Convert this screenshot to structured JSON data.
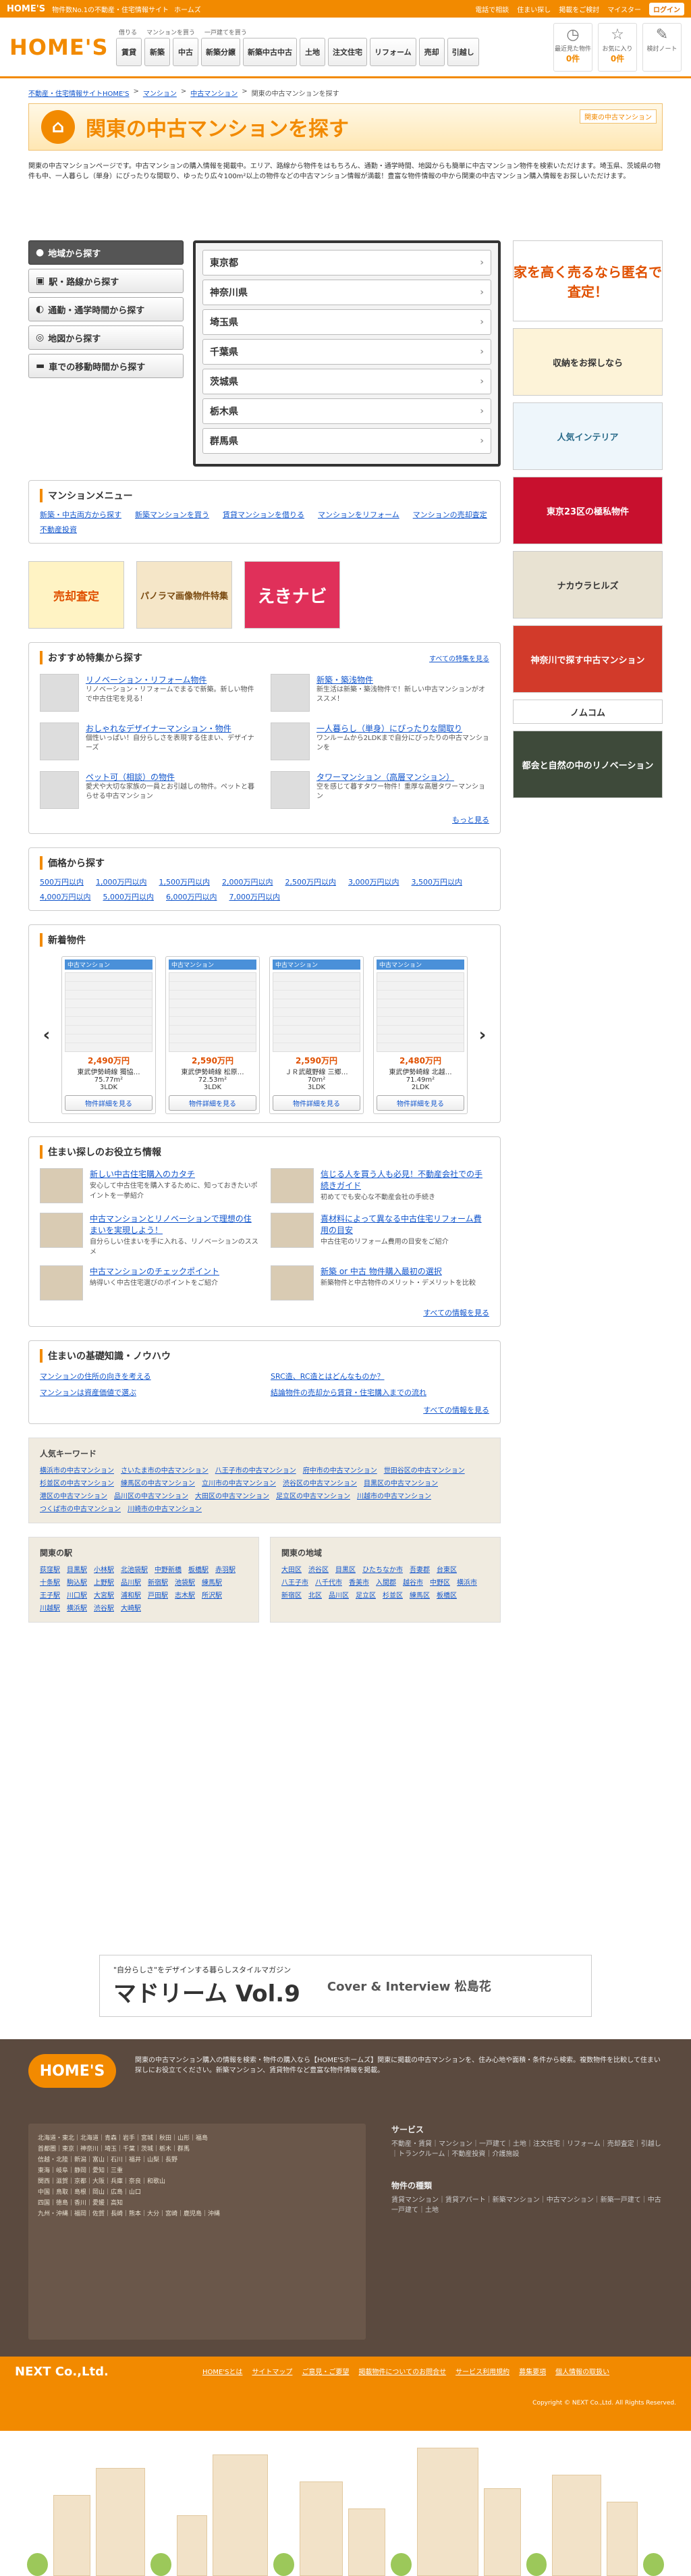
{
  "topbar": {
    "brand": "HOME'S",
    "links": [
      "物件数No.1の不動産・住宅情報サイト",
      "ホームズ"
    ],
    "right": [
      "電話で相談",
      "住まい探し",
      "掲載をご検討",
      "マイスター"
    ],
    "login": "ログイン"
  },
  "header": {
    "logo": "HOME'S",
    "nav_labels": [
      "借りる",
      "マンションを買う",
      "一戸建てを買う"
    ],
    "nav": [
      "賃貸",
      "新築",
      "中古",
      "新築分譲",
      "新築中古中古",
      "土地",
      "注文住宅",
      "リフォーム",
      "売却",
      "引越し"
    ],
    "icons": [
      {
        "name": "最近見た物件",
        "count": "0件"
      },
      {
        "name": "お気に入り",
        "count": "0件"
      },
      {
        "name": "検討ノート",
        "count": ""
      }
    ]
  },
  "breadcrumb": [
    "不動産・住宅情報サイトHOME'S",
    "マンション",
    "中古マンション",
    "関東の中古マンションを探す"
  ],
  "title": {
    "text": "関東の中古マンションを探す",
    "tag": "関東の中古マンション"
  },
  "intro": "関東の中古マンションページです。中古マンションの購入情報を掲載中。エリア、路線から物件をはもちろん、通勤・通学時間、地図からも簡単に中古マンション物件を検索いただけます。埼玉県、茨城県の物件も中、一人暮らし（単身）にぴったりな間取り、ゆったり広々100m²以上の物件などの中古マンション情報が満載！豊富な物件情報の中から関東の中古マンション購入情報をお探しいただけます。",
  "search": {
    "tabs": [
      "地域から探す",
      "駅・路線から探す",
      "通勤・通学時間から探す",
      "地図から探す",
      "車での移動時間から探す"
    ],
    "prefs": [
      "東京都",
      "神奈川県",
      "埼玉県",
      "千葉県",
      "茨城県",
      "栃木県",
      "群馬県"
    ]
  },
  "menu": {
    "title": "マンションメニュー",
    "links": [
      "新築・中古両方から探す",
      "新築マンションを買う",
      "賃貸マンションを借りる",
      "マンションをリフォーム",
      "マンションの売却査定",
      "不動産投資"
    ]
  },
  "promo": [
    "売却査定",
    "パノラマ画像物件特集",
    "えきナビ"
  ],
  "features": {
    "title": "おすすめ特集から探す",
    "more": "すべての特集を見る",
    "items": [
      {
        "t": "リノベーション・リフォーム物件",
        "d": "リノベーション・リフォームでまるで新築。新しい物件で中古住宅を見る！"
      },
      {
        "t": "新築・築浅物件",
        "d": "新生活は新築・築浅物件で！新しい中古マンションがオススメ！"
      },
      {
        "t": "おしゃれなデザイナーマンション・物件",
        "d": "個性いっぱい！自分らしさを表現する住まい、デザイナーズ"
      },
      {
        "t": "一人暮らし（単身）にぴったりな間取り",
        "d": "ワンルームから2LDKまで自分にぴったりの中古マンションを"
      },
      {
        "t": "ペット可（相談）の物件",
        "d": "愛犬や大切な家族の一員とお引越しの物件。ペットと暮らせる中古マンション"
      },
      {
        "t": "タワーマンション（高層マンション）",
        "d": "空を感じて暮すタワー物件！重厚な高層タワーマンション"
      }
    ],
    "more2": "もっと見る"
  },
  "price": {
    "title": "価格から探す",
    "links": [
      "500万円以内",
      "1,000万円以内",
      "1,500万円以内",
      "2,000万円以内",
      "2,500万円以内",
      "3,000万円以内",
      "3,500万円以内",
      "4,000万円以内",
      "5,000万円以内",
      "6,000万円以内",
      "7,000万円以内"
    ]
  },
  "newlistings": {
    "title": "新着物件",
    "cards": [
      {
        "lab": "中古マンション",
        "price": "2,490万円",
        "name": "東武伊勢崎線 獨協…",
        "size": "75.77m²",
        "plan": "3LDK",
        "btn": "物件詳細を見る"
      },
      {
        "lab": "中古マンション",
        "price": "2,590万円",
        "name": "東武伊勢崎線 松原…",
        "size": "72.53m²",
        "plan": "3LDK",
        "btn": "物件詳細を見る"
      },
      {
        "lab": "中古マンション",
        "price": "2,590万円",
        "name": "ＪＲ武蔵野線 三郷…",
        "size": "70m²",
        "plan": "3LDK",
        "btn": "物件詳細を見る"
      },
      {
        "lab": "中古マンション",
        "price": "2,480万円",
        "name": "東武伊勢崎線 北越…",
        "size": "71.49m²",
        "plan": "2LDK",
        "btn": "物件詳細を見る"
      }
    ]
  },
  "info": {
    "title": "住まい探しのお役立ち情報",
    "more": "すべての情報を見る",
    "items": [
      {
        "t": "新しい中古住宅購入のカタチ",
        "d": "安心して中古住宅を購入するために、知っておきたいポイントを一挙紹介"
      },
      {
        "t": "信じる人を買う人も必見！不動産会社での手続きガイド",
        "d": "初めてでも安心な不動産会社の手続き"
      },
      {
        "t": "中古マンションとリノベーションで理想の住まいを実現しよう！",
        "d": "自分らしい住まいを手に入れる、リノベーションのススメ"
      },
      {
        "t": "喜材料によって異なる中古住宅リフォーム費用の目安",
        "d": "中古住宅のリフォーム費用の目安をご紹介"
      },
      {
        "t": "中古マンションのチェックポイント",
        "d": "納得いく中古住宅選びのポイントをご紹介"
      },
      {
        "t": "新築 or 中古 物件購入最初の選択",
        "d": "新築物件と中古物件のメリット・デメリットを比較"
      }
    ]
  },
  "basic": {
    "title": "住まいの基礎知識・ノウハウ",
    "more": "すべての情報を見る",
    "links": [
      "マンションの住所の向きを考える",
      "SRC造、RC造とはどんなものか？",
      "マンションは資産価値で選ぶ",
      "結論物件の売却から賃貸・住宅購入までの流れ"
    ]
  },
  "keywords": {
    "title": "人気キーワード",
    "items": [
      "横浜市の中古マンション",
      "さいたま市の中古マンション",
      "八王子市の中古マンション",
      "府中市の中古マンション",
      "世田谷区の中古マンション",
      "杉並区の中古マンション",
      "練馬区の中古マンション",
      "立川市の中古マンション",
      "渋谷区の中古マンション",
      "目黒区の中古マンション",
      "港区の中古マンション",
      "品川区の中古マンション",
      "大田区の中古マンション",
      "足立区の中古マンション",
      "川越市の中古マンション",
      "つくば市の中古マンション",
      "川崎市の中古マンション"
    ]
  },
  "stations": {
    "title": "関東の駅",
    "items": [
      "荻窪駅",
      "目黒駅",
      "小林駅",
      "北池袋駅",
      "中野新橋",
      "板橋駅",
      "赤羽駅",
      "十条駅",
      "駒込駅",
      "上野駅",
      "品川駅",
      "新宿駅",
      "池袋駅",
      "練馬駅",
      "王子駅",
      "川口駅",
      "大宮駅",
      "浦和駅",
      "戸田駅",
      "志木駅",
      "所沢駅",
      "川越駅",
      "横浜駅",
      "渋谷駅",
      "大崎駅"
    ]
  },
  "areas": {
    "title": "関東の地域",
    "items": [
      "大田区",
      "渋谷区",
      "目黒区",
      "ひたちなか市",
      "吾妻郡",
      "台東区",
      "八王子市",
      "八千代市",
      "香美市",
      "入間郡",
      "越谷市",
      "中野区",
      "横浜市",
      "新宿区",
      "北区",
      "品川区",
      "足立区",
      "杉並区",
      "練馬区",
      "板橋区"
    ]
  },
  "ad": {
    "sub": "\"自分らしさ\"をデザインする暮らしスタイルマガジン",
    "title": "マドリーム Vol.9",
    "right": "Cover & Interview 松島花"
  },
  "sideads": [
    "家を高く売るなら匿名で査定！",
    "収納をお探しなら",
    "人気インテリア",
    "東京23区の極私物件",
    "ナカウラヒルズ",
    "神奈川で探す中古マンション",
    "ノムコム",
    "都会と自然の中のリノベーション"
  ],
  "footer": {
    "logo": "HOME'S",
    "text": "関東の中古マンション購入の情報を検索・物件の購入なら【HOME'Sホームズ】関東に掲載の中古マンションを、住み心地や面積・条件から検索。複数物件を比較して住まい探しにお役立てください。新築マンション、賃貸物件など豊富な物件情報を掲載。",
    "service_title": "サービス",
    "areas_title": "物件の種類",
    "bottom_links": [
      "HOME'Sとは",
      "サイトマップ",
      "ご意見・ご要望",
      "掲載物件についてのお問合せ",
      "サービス利用規約",
      "募集要項",
      "個人情報の取扱い"
    ],
    "copyright": "Copyright © NEXT Co.,Ltd. All Rights Reserved.",
    "company": "NEXT Co.,Ltd."
  }
}
